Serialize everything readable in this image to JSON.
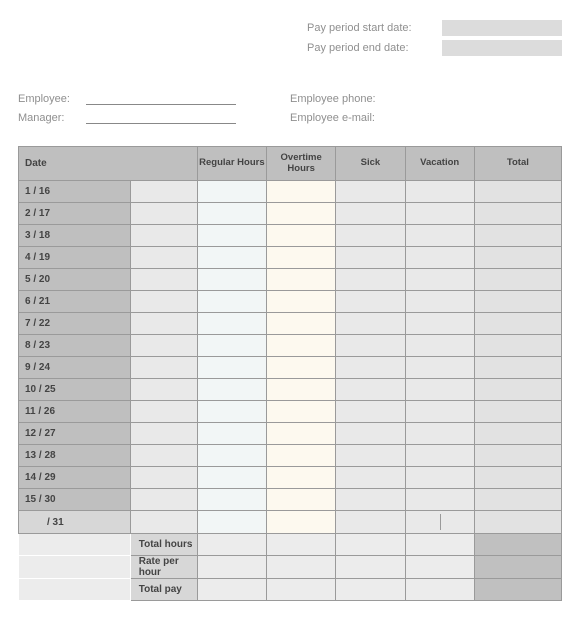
{
  "meta": {
    "pay_start_label": "Pay period start date:",
    "pay_end_label": "Pay period end date:",
    "pay_start_value": "",
    "pay_end_value": ""
  },
  "info": {
    "employee_label": "Employee:",
    "manager_label": "Manager:",
    "phone_label": "Employee phone:",
    "email_label": "Employee e-mail:",
    "employee_value": "",
    "manager_value": "",
    "phone_value": "",
    "email_value": ""
  },
  "headers": {
    "date": "Date",
    "regular": "Regular Hours",
    "overtime": "Overtime Hours",
    "sick": "Sick",
    "vacation": "Vacation",
    "total": "Total"
  },
  "rows": [
    {
      "date": "1 / 16",
      "regular": "",
      "overtime": "",
      "sick": "",
      "vacation": "",
      "total": ""
    },
    {
      "date": "2 / 17",
      "regular": "",
      "overtime": "",
      "sick": "",
      "vacation": "",
      "total": ""
    },
    {
      "date": "3 / 18",
      "regular": "",
      "overtime": "",
      "sick": "",
      "vacation": "",
      "total": ""
    },
    {
      "date": "4 / 19",
      "regular": "",
      "overtime": "",
      "sick": "",
      "vacation": "",
      "total": ""
    },
    {
      "date": "5 / 20",
      "regular": "",
      "overtime": "",
      "sick": "",
      "vacation": "",
      "total": ""
    },
    {
      "date": "6 / 21",
      "regular": "",
      "overtime": "",
      "sick": "",
      "vacation": "",
      "total": ""
    },
    {
      "date": "7 / 22",
      "regular": "",
      "overtime": "",
      "sick": "",
      "vacation": "",
      "total": ""
    },
    {
      "date": "8 / 23",
      "regular": "",
      "overtime": "",
      "sick": "",
      "vacation": "",
      "total": ""
    },
    {
      "date": "9 / 24",
      "regular": "",
      "overtime": "",
      "sick": "",
      "vacation": "",
      "total": ""
    },
    {
      "date": "10 / 25",
      "regular": "",
      "overtime": "",
      "sick": "",
      "vacation": "",
      "total": ""
    },
    {
      "date": "11 / 26",
      "regular": "",
      "overtime": "",
      "sick": "",
      "vacation": "",
      "total": ""
    },
    {
      "date": "12 / 27",
      "regular": "",
      "overtime": "",
      "sick": "",
      "vacation": "",
      "total": ""
    },
    {
      "date": "13 / 28",
      "regular": "",
      "overtime": "",
      "sick": "",
      "vacation": "",
      "total": ""
    },
    {
      "date": "14 / 29",
      "regular": "",
      "overtime": "",
      "sick": "",
      "vacation": "",
      "total": ""
    },
    {
      "date": "15 / 30",
      "regular": "",
      "overtime": "",
      "sick": "",
      "vacation": "",
      "total": ""
    },
    {
      "date": "   / 31",
      "regular": "",
      "overtime": "",
      "sick": "",
      "vacation": "",
      "total": ""
    }
  ],
  "summary": {
    "total_hours_label": "Total hours",
    "rate_label": "Rate per hour",
    "total_pay_label": "Total pay",
    "total_hours": {
      "regular": "",
      "overtime": "",
      "sick": "",
      "vacation": "",
      "total": ""
    },
    "rate": {
      "regular": "",
      "overtime": "",
      "sick": "",
      "vacation": "",
      "total": ""
    },
    "total_pay": {
      "regular": "",
      "overtime": "",
      "sick": "",
      "vacation": "",
      "total": ""
    }
  }
}
